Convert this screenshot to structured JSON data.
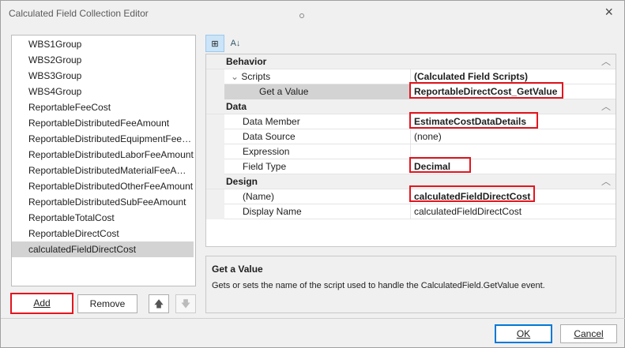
{
  "window": {
    "title": "Calculated Field Collection Editor",
    "close_icon": "×"
  },
  "list": {
    "items": [
      "WBS1Group",
      "WBS2Group",
      "WBS3Group",
      "WBS4Group",
      "ReportableFeeCost",
      "ReportableDistributedFeeAmount",
      "ReportableDistributedEquipmentFeeAmo...",
      "ReportableDistributedLaborFeeAmount",
      "ReportableDistributedMaterialFeeAmount",
      "ReportableDistributedOtherFeeAmount",
      "ReportableDistributedSubFeeAmount",
      "ReportableTotalCost",
      "ReportableDirectCost",
      "calculatedFieldDirectCost"
    ],
    "selected_index": 13
  },
  "buttons": {
    "add": "Add",
    "remove": "Remove",
    "up": "🡅",
    "down": "🡇",
    "ok": "OK",
    "cancel": "Cancel"
  },
  "grid": {
    "behavior": {
      "label": "Behavior",
      "scripts": {
        "name": "Scripts",
        "value": "(Calculated Field Scripts)"
      },
      "get_value": {
        "name": "Get a Value",
        "value": "ReportableDirectCost_GetValue"
      }
    },
    "data": {
      "label": "Data",
      "data_member": {
        "name": "Data Member",
        "value": "EstimateCostDataDetails"
      },
      "data_source": {
        "name": "Data Source",
        "value": "(none)"
      },
      "expression": {
        "name": "Expression",
        "value": ""
      },
      "field_type": {
        "name": "Field Type",
        "value": "Decimal"
      }
    },
    "design": {
      "label": "Design",
      "name": {
        "name": "(Name)",
        "value": "calculatedFieldDirectCost"
      },
      "display_name": {
        "name": "Display Name",
        "value": "calculatedFieldDirectCost"
      }
    }
  },
  "description": {
    "title": "Get a Value",
    "text": "Gets or sets the name of the script used to handle the CalculatedField.GetValue event."
  },
  "colors": {
    "highlight": "#e3151e"
  }
}
